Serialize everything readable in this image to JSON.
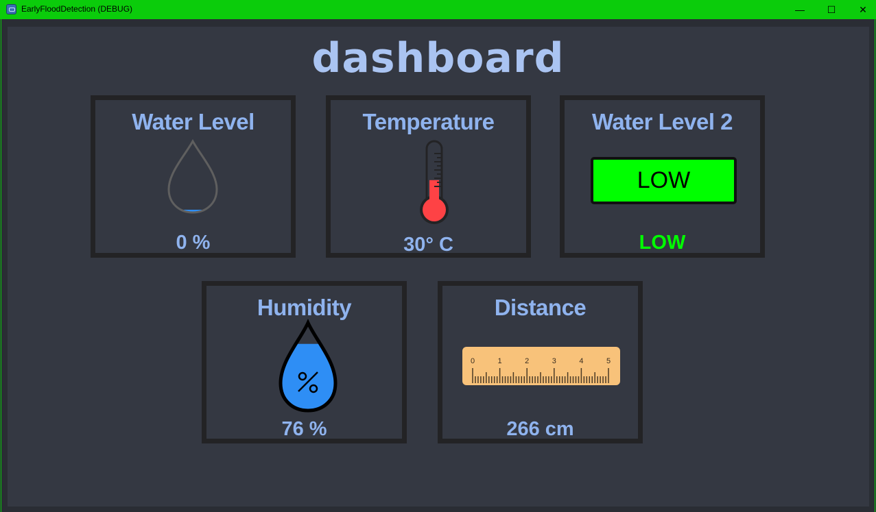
{
  "window": {
    "title": "EarlyFloodDetection (DEBUG)",
    "minimize_glyph": "—",
    "maximize_glyph": "☐",
    "close_glyph": "✕",
    "titlebar_color": "#0bcc0b"
  },
  "dashboard": {
    "title": "dashboard",
    "cards": {
      "water_level": {
        "title": "Water Level",
        "value": "0 %",
        "fill_fraction": 0.0,
        "icon": "water-drop-icon"
      },
      "temperature": {
        "title": "Temperature",
        "value": "30° C",
        "fill_fraction": 0.45,
        "icon": "thermometer-icon",
        "fill_color": "#fe4245"
      },
      "water_level_2": {
        "title": "Water Level 2",
        "status_box": "LOW",
        "status_text": "LOW",
        "status_color": "#00ff00"
      },
      "humidity": {
        "title": "Humidity",
        "value": "76 %",
        "fill_fraction": 0.76,
        "icon": "humidity-drop-icon",
        "fill_color": "#2e8ef5"
      },
      "distance": {
        "title": "Distance",
        "value": "266 cm",
        "icon": "ruler-icon",
        "ruler_labels": [
          "0",
          "1",
          "2",
          "3",
          "4",
          "5"
        ]
      }
    }
  }
}
